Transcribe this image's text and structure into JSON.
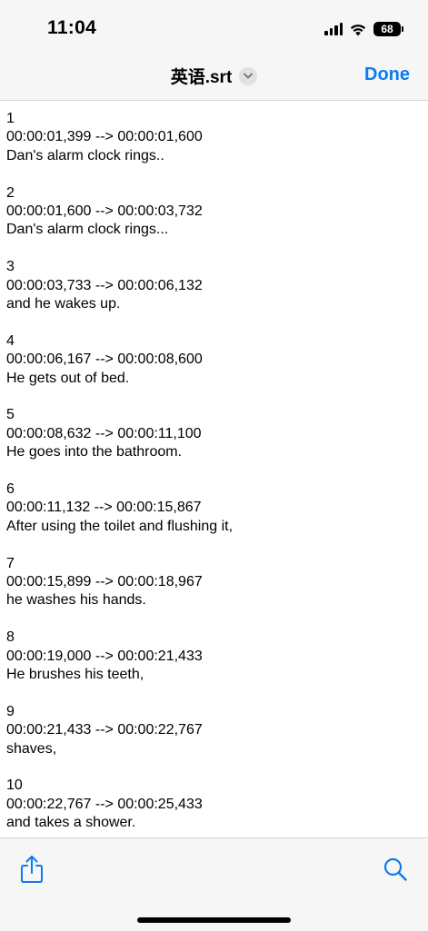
{
  "status_bar": {
    "time": "11:04",
    "battery_level": "68",
    "icons": [
      "cellular-signal-icon",
      "wifi-icon",
      "battery-icon"
    ]
  },
  "nav": {
    "title": "英语.srt",
    "title_menu_icon": "chevron-down-icon",
    "done_label": "Done"
  },
  "subtitles": [
    {
      "index": "1",
      "timing": "00:00:01,399 --> 00:00:01,600",
      "text": "Dan's alarm clock rings.."
    },
    {
      "index": "2",
      "timing": "00:00:01,600 --> 00:00:03,732",
      "text": "Dan's alarm clock rings..."
    },
    {
      "index": "3",
      "timing": "00:00:03,733 --> 00:00:06,132",
      "text": "and he wakes up."
    },
    {
      "index": "4",
      "timing": "00:00:06,167 --> 00:00:08,600",
      "text": "He gets out of bed."
    },
    {
      "index": "5",
      "timing": "00:00:08,632 --> 00:00:11,100",
      "text": "He goes into the bathroom."
    },
    {
      "index": "6",
      "timing": "00:00:11,132 --> 00:00:15,867",
      "text": "After using the toilet and flushing it,"
    },
    {
      "index": "7",
      "timing": "00:00:15,899 --> 00:00:18,967",
      "text": "he washes his hands."
    },
    {
      "index": "8",
      "timing": "00:00:19,000 --> 00:00:21,433",
      "text": "He brushes his teeth,"
    },
    {
      "index": "9",
      "timing": "00:00:21,433 --> 00:00:22,767",
      "text": "shaves,"
    },
    {
      "index": "10",
      "timing": "00:00:22,767 --> 00:00:25,433",
      "text": "and takes a shower."
    }
  ],
  "toolbar": {
    "left_icon": "share-icon",
    "right_icon": "search-icon"
  },
  "colors": {
    "accent": "#0a7bf5",
    "bar_background": "#f6f6f7",
    "separator": "#d6d6d8"
  }
}
